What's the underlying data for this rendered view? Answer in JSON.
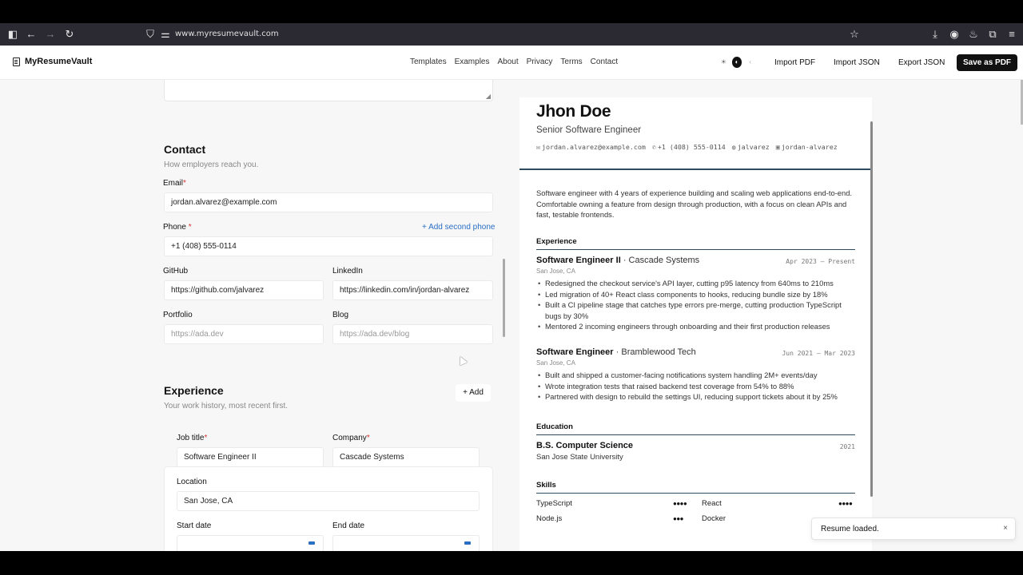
{
  "browser": {
    "url": "www.myresumevault.com",
    "icons": [
      "sidebar-icon",
      "back-icon",
      "forward-icon",
      "reload-icon",
      "shield-icon",
      "permissions-icon",
      "bookmark-star-icon",
      "download-icon",
      "account-icon",
      "extension-icon",
      "puzzle-icon",
      "menu-icon"
    ]
  },
  "header": {
    "brand": "MyResumeVault",
    "nav": [
      "Templates",
      "Examples",
      "About",
      "Privacy",
      "Terms",
      "Contact"
    ],
    "buttons": {
      "import_pdf": "Import PDF",
      "import_json": "Import JSON",
      "export_json": "Export JSON",
      "save_pdf": "Save as PDF"
    }
  },
  "editor": {
    "contact": {
      "title": "Contact",
      "subtitle": "How employers reach you.",
      "email_label": "Email",
      "email_value": "jordan.alvarez@example.com",
      "phone_label": "Phone",
      "add_second_phone": "+ Add second phone",
      "phone_value": "+1 (408) 555-0114",
      "github_label": "GitHub",
      "github_value": "https://github.com/jalvarez",
      "linkedin_label": "LinkedIn",
      "linkedin_value": "https://linkedin.com/in/jordan-alvarez",
      "portfolio_label": "Portfolio",
      "portfolio_placeholder": "https://ada.dev",
      "blog_label": "Blog",
      "blog_placeholder": "https://ada.dev/blog",
      "required_mark": "*"
    },
    "experience": {
      "title": "Experience",
      "subtitle": "Your work history, most recent first.",
      "add_label": "+ Add",
      "job_title_label": "Job title",
      "job_title_value": "Software Engineer II",
      "company_label": "Company",
      "company_value": "Cascade Systems",
      "location_label": "Location",
      "location_value": "San Jose, CA",
      "start_label": "Start date",
      "end_label": "End date"
    }
  },
  "resume": {
    "name": "Jhon Doe",
    "title": "Senior Software Engineer",
    "contact": {
      "email": "jordan.alvarez@example.com",
      "phone": "+1 (408) 555-0114",
      "github": "jalvarez",
      "linkedin": "jordan-alvarez"
    },
    "summary": "Software engineer with 4 years of experience building and scaling web applications end-to-end. Comfortable owning a feature from design through production, with a focus on clean APIs and fast, testable frontends.",
    "experience_heading": "Experience",
    "jobs": [
      {
        "role": "Software Engineer II",
        "company": "· Cascade Systems",
        "dates": "Apr 2023 — Present",
        "location": "San Jose, CA",
        "bullets": [
          "Redesigned the checkout service's API layer, cutting p95 latency from 640ms to 210ms",
          "Led migration of 40+ React class components to hooks, reducing bundle size by 18%",
          "Built a CI pipeline stage that catches type errors pre-merge, cutting production TypeScript bugs by 30%",
          "Mentored 2 incoming engineers through onboarding and their first production releases"
        ]
      },
      {
        "role": "Software Engineer",
        "company": "· Bramblewood Tech",
        "dates": "Jun 2021 — Mar 2023",
        "location": "San Jose, CA",
        "bullets": [
          "Built and shipped a customer-facing notifications system handling 2M+ events/day",
          "Wrote integration tests that raised backend test coverage from 54% to 88%",
          "Partnered with design to rebuild the settings UI, reducing support tickets about it by 25%"
        ]
      }
    ],
    "education_heading": "Education",
    "education": {
      "degree": "B.S. Computer Science",
      "school": "San Jose State University",
      "year": "2021"
    },
    "skills_heading": "Skills",
    "skills": [
      {
        "name": "TypeScript",
        "dots": "●●●●",
        "level": 4
      },
      {
        "name": "React",
        "dots": "●●●●",
        "level": 4
      },
      {
        "name": "Node.js",
        "dots": "●●●",
        "level": 3
      },
      {
        "name": "Docker",
        "dots": "",
        "level": null
      }
    ]
  },
  "toast": {
    "message": "Resume loaded.",
    "close": "×"
  }
}
